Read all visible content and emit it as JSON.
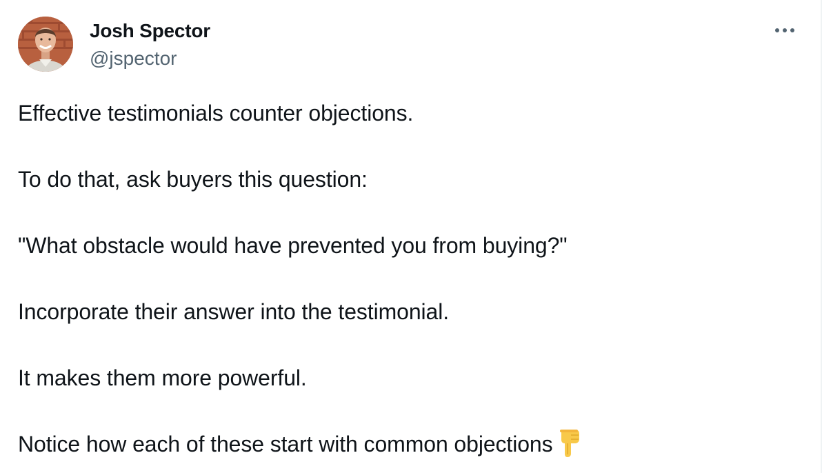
{
  "author": {
    "display_name": "Josh Spector",
    "handle": "@jspector"
  },
  "more_menu": {
    "icon": "more-horizontal-icon"
  },
  "tweet": {
    "lines": [
      "Effective testimonials counter objections.",
      "To do that, ask buyers this question:",
      "\"What obstacle would have prevented you from buying?\"",
      "Incorporate their answer into the testimonial.",
      "It makes them more powerful.",
      "Notice how each of these start with common objections"
    ],
    "trailing_emoji": "pointing-down-icon"
  },
  "colors": {
    "text_primary": "#0f1419",
    "text_secondary": "#536471",
    "background": "#ffffff",
    "emoji_yellow": "#f8c94a"
  }
}
